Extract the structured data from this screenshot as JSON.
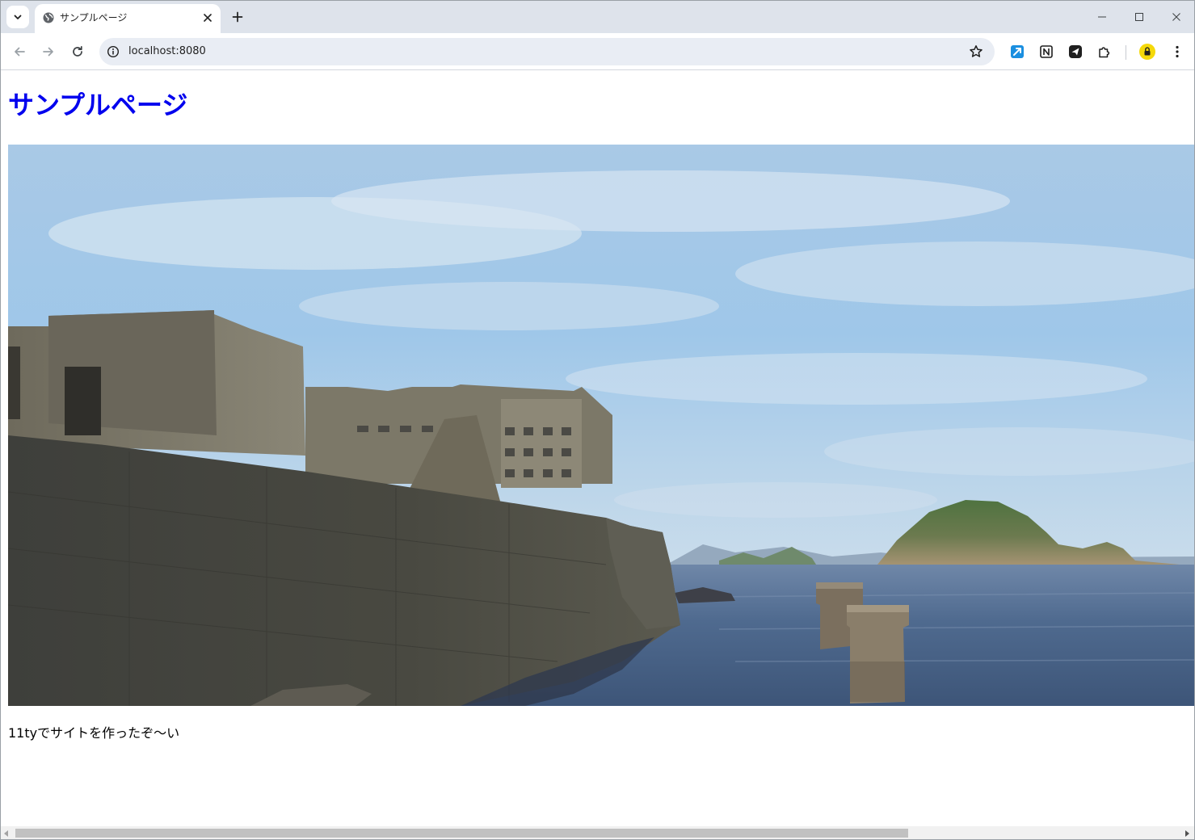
{
  "browser": {
    "tab": {
      "title": "サンプルページ",
      "favicon": "globe-icon"
    },
    "omnibox": {
      "url": "localhost:8080",
      "icon": "info-icon"
    },
    "extensions": [
      "ext-blue-arrow-icon",
      "notion-icon",
      "send-icon",
      "puzzle-icon"
    ],
    "profile_icon": "profile-lock-icon",
    "colors": {
      "tabstrip": "#dee3eb",
      "omnibox": "#e9edf4",
      "link_heading": "#0000ee"
    }
  },
  "page": {
    "heading": "サンプルページ",
    "image": {
      "subject": "sea-cliff-fortress-photo"
    },
    "paragraph": "11tyでサイトを作ったぞ〜い"
  },
  "scrollbar": {
    "horizontal_position_fraction": 0
  }
}
